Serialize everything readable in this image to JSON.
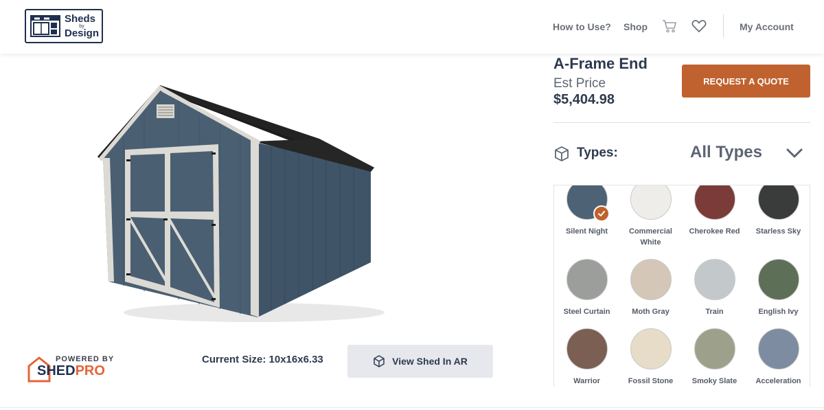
{
  "header": {
    "logo_text_1": "Sheds",
    "logo_text_by": "by",
    "logo_text_2": "Design",
    "nav": {
      "how_to_use": "How to Use?",
      "shop": "Shop",
      "my_account": "My Account"
    },
    "icons": [
      "cart-icon",
      "heart-icon"
    ]
  },
  "preview": {
    "current_size_label": "Current Size: 10x16x6.33",
    "ar_button_label": "View Shed In AR",
    "powered_by": "POWERED BY",
    "brand_1": "SHED",
    "brand_2": "PRO"
  },
  "product": {
    "title": "A-Frame End",
    "est_label": "Est Price",
    "price": "$5,404.98",
    "quote_label": "REQUEST A QUOTE"
  },
  "types": {
    "label": "Types:",
    "value": "All Types"
  },
  "swatches": [
    {
      "name": "Silent Night",
      "color": "#4d6274",
      "selected": true
    },
    {
      "name": "Commercial White",
      "color": "#eeede9",
      "selected": false
    },
    {
      "name": "Cherokee Red",
      "color": "#7a3b39",
      "selected": false
    },
    {
      "name": "Starless Sky",
      "color": "#3a3c3c",
      "selected": false
    },
    {
      "name": "Steel Curtain",
      "color": "#9c9e9b",
      "selected": false
    },
    {
      "name": "Moth Gray",
      "color": "#d4c7b8",
      "selected": false
    },
    {
      "name": "Train",
      "color": "#c3c9ca",
      "selected": false
    },
    {
      "name": "English Ivy",
      "color": "#5e6f58",
      "selected": false
    },
    {
      "name": "Warrior",
      "color": "#7b5f52",
      "selected": false
    },
    {
      "name": "Fossil Stone",
      "color": "#e6dcc8",
      "selected": false
    },
    {
      "name": "Smoky Slate",
      "color": "#9da08b",
      "selected": false
    },
    {
      "name": "Acceleration",
      "color": "#7d8ca0",
      "selected": false
    }
  ],
  "colors": {
    "accent": "#c0622f",
    "navy": "#1f2f4f",
    "shed_siding": "#4a5f72",
    "shed_trim": "#dcdad4",
    "roof": "#1c1c1c"
  }
}
